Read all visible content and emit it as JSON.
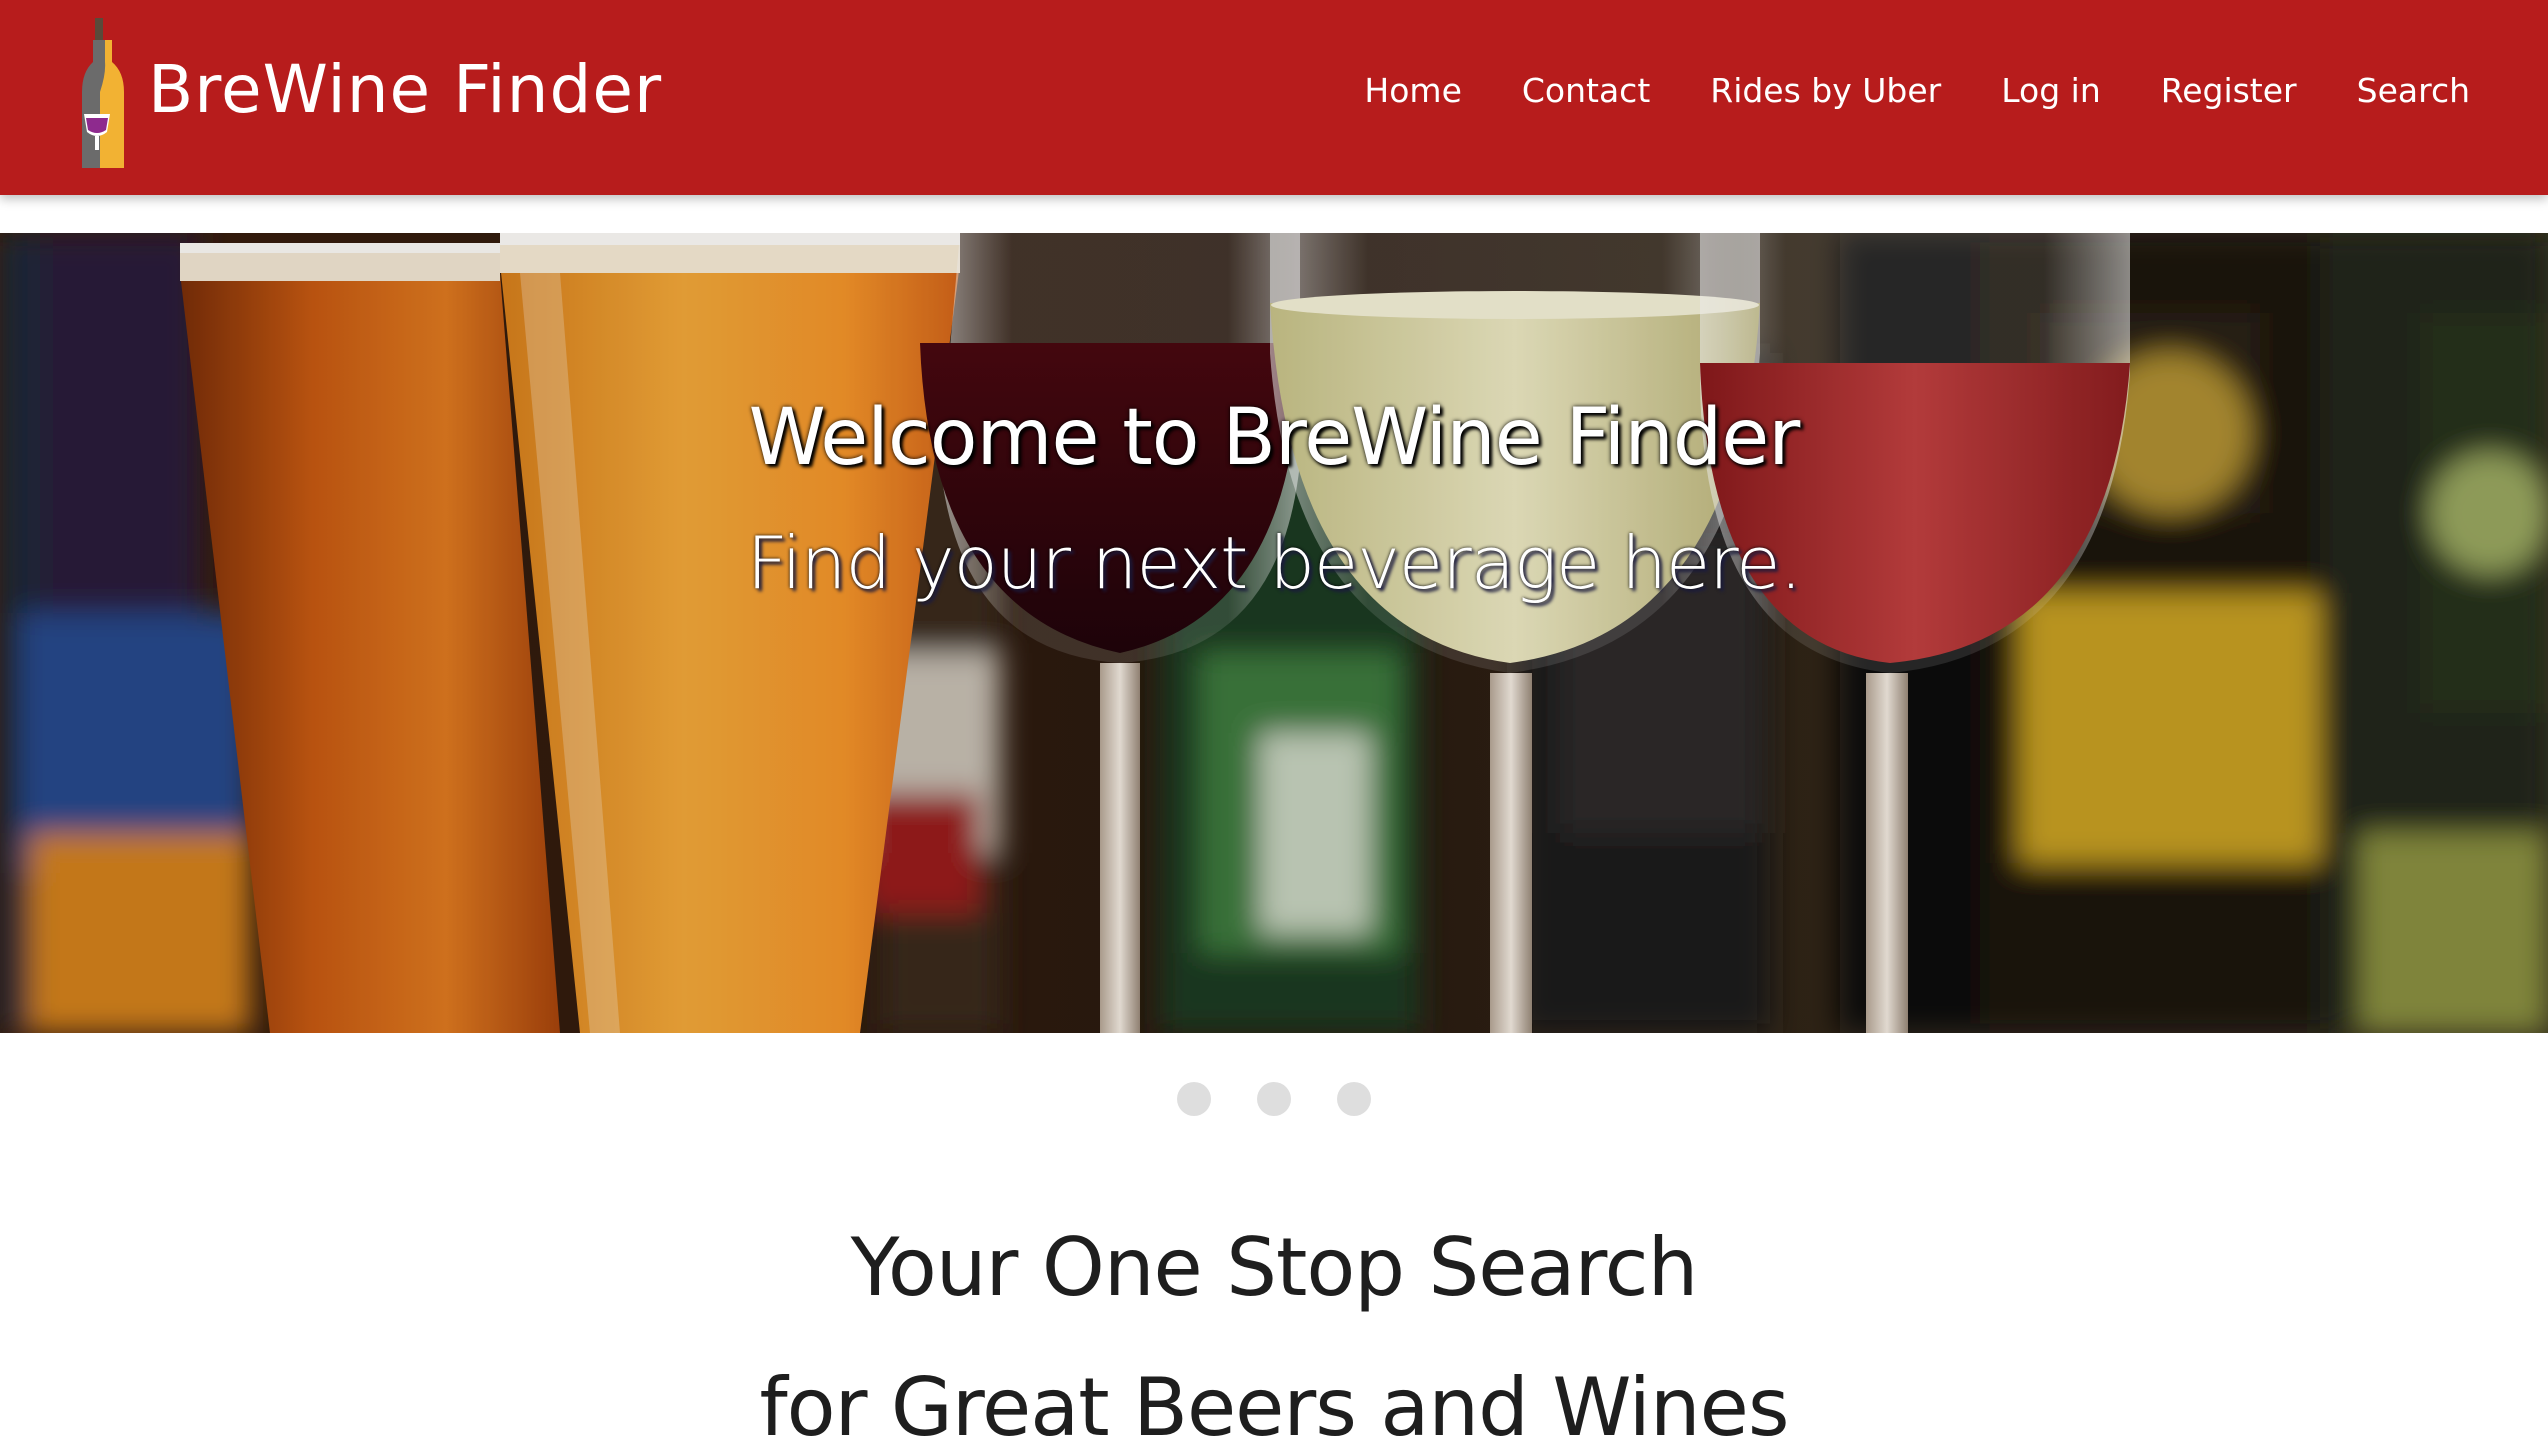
{
  "header": {
    "brand": "BreWine Finder",
    "nav": [
      {
        "label": "Home"
      },
      {
        "label": "Contact"
      },
      {
        "label": "Rides by Uber"
      },
      {
        "label": "Log in"
      },
      {
        "label": "Register"
      },
      {
        "label": "Search"
      }
    ]
  },
  "hero": {
    "title": "Welcome to BreWine Finder",
    "subtitle": "Find your next beverage here.",
    "slides_count": 3,
    "active_slide": 1
  },
  "main": {
    "headline_line1": "Your One Stop Search",
    "headline_line2": "for Great Beers and Wines"
  },
  "colors": {
    "header_bg": "#b71c1c",
    "indicator": "#dedede",
    "text": "#1e1e1e"
  }
}
